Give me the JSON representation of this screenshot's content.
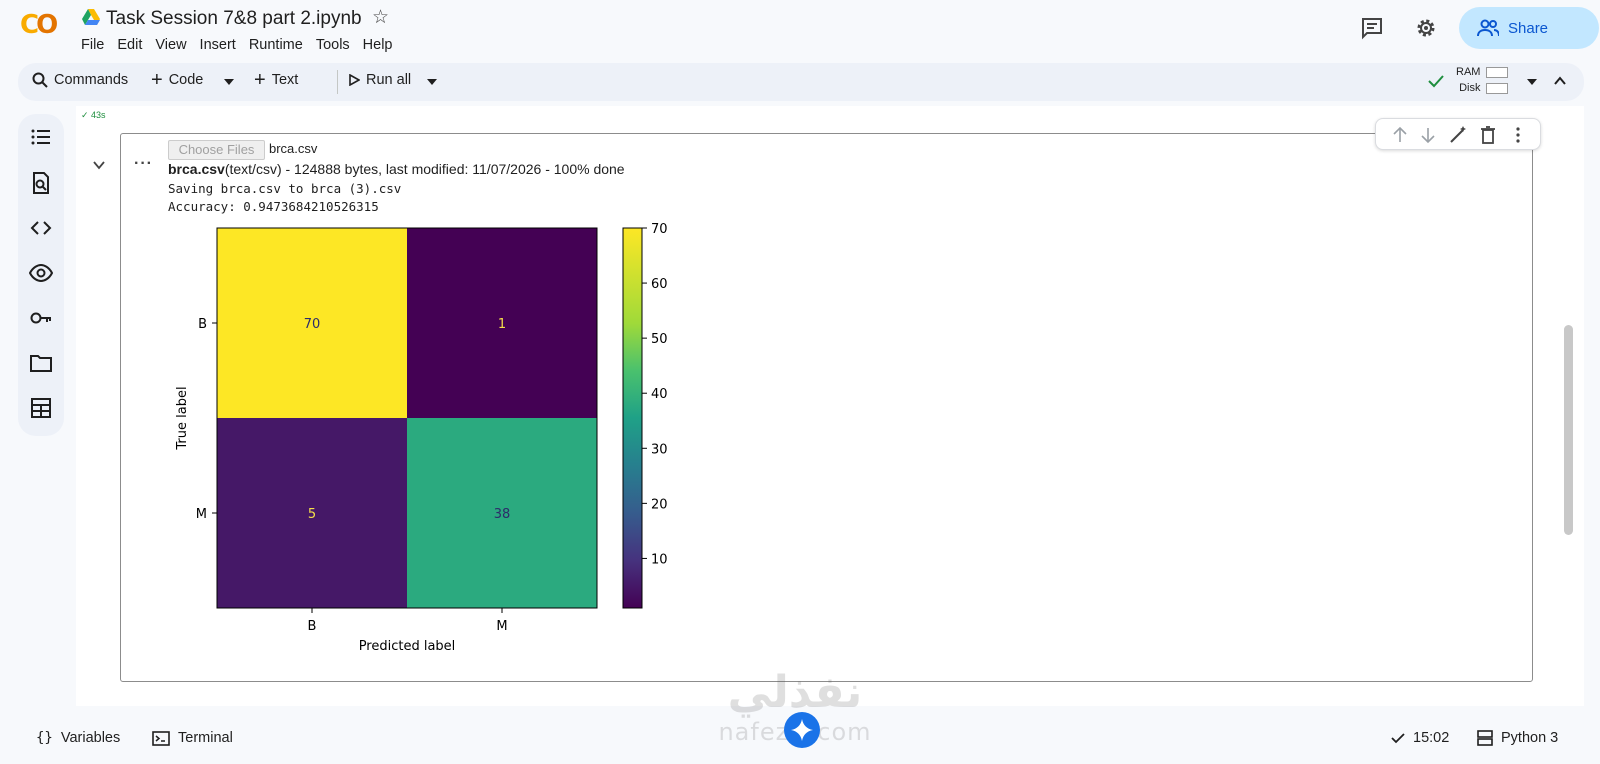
{
  "header": {
    "title": "Task Session 7&8 part 2.ipynb",
    "menu": [
      "File",
      "Edit",
      "View",
      "Insert",
      "Runtime",
      "Tools",
      "Help"
    ],
    "share_label": "Share"
  },
  "toolbar": {
    "commands_label": "Commands",
    "code_label": "Code",
    "text_label": "Text",
    "run_all_label": "Run all",
    "ram_label": "RAM",
    "disk_label": "Disk"
  },
  "cell": {
    "exec_status": "43s",
    "choose_files_label": "Choose Files",
    "chosen_file": "brca.csv",
    "file_name": "brca.csv",
    "file_type": "(text/csv)",
    "file_details": " - 124888 bytes, last modified: 11/07/2026 - 100% done",
    "saving_line": "Saving brca.csv to brca (3).csv",
    "accuracy_line": "Accuracy: 0.9473684210526315"
  },
  "chart_data": {
    "type": "heatmap",
    "x_categories": [
      "B",
      "M"
    ],
    "y_categories": [
      "B",
      "M"
    ],
    "values": [
      [
        70,
        1
      ],
      [
        5,
        38
      ]
    ],
    "xlabel": "Predicted label",
    "ylabel": "True label",
    "colorbar_ticks": [
      10,
      20,
      30,
      40,
      50,
      60,
      70
    ],
    "colorbar_range": [
      1,
      70
    ],
    "colormap": "viridis"
  },
  "bottombar": {
    "variables_label": "Variables",
    "terminal_label": "Terminal",
    "time_label": "15:02",
    "runtime_label": "Python 3"
  },
  "watermark": {
    "arabic": "نفذلي",
    "latin": "nafezly.com"
  },
  "colors": {
    "accent": "#0b57d0",
    "share_bg": "#c2e7ff",
    "success": "#1e8e3e"
  }
}
